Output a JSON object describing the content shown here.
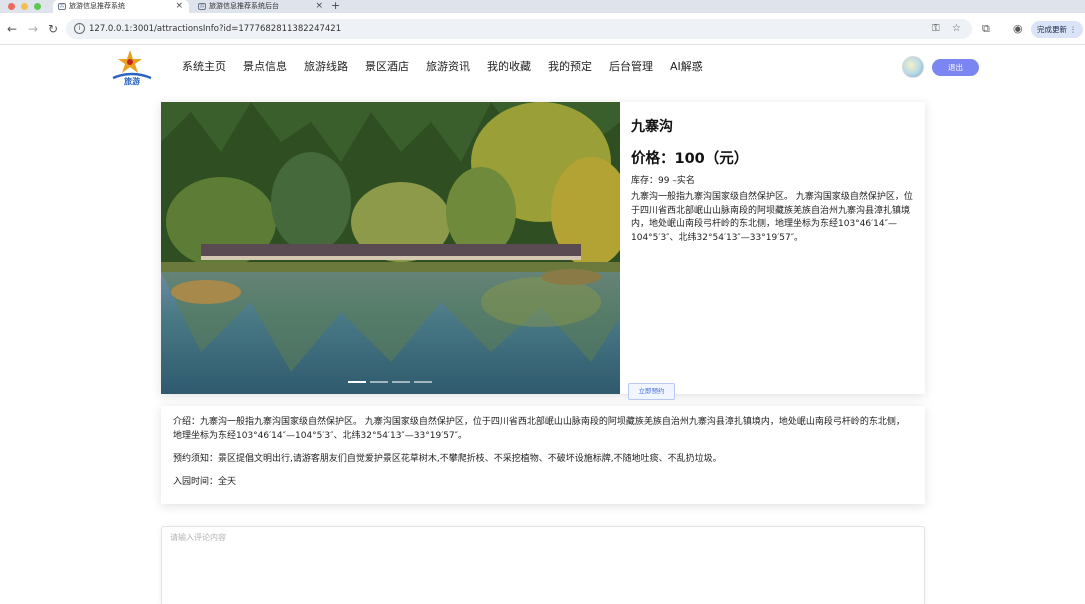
{
  "browser": {
    "tabs": [
      {
        "title": "旅游信息推荐系统",
        "favicon": "yun"
      },
      {
        "title": "旅游信息推荐系统后台",
        "favicon": "yun"
      }
    ],
    "url": "127.0.0.1:3001/attractionsInfo?id=1777682811382247421",
    "update_label": "完成更新"
  },
  "site": {
    "logo_text": "旅游",
    "nav": [
      "系统主页",
      "景点信息",
      "旅游线路",
      "景区酒店",
      "旅游资讯",
      "我的收藏",
      "我的预定",
      "后台管理",
      "AI解惑"
    ],
    "logout_label": "退出",
    "accent": "#7b86f2"
  },
  "attraction": {
    "name": "九寨沟",
    "price_text": "价格：100（元）",
    "stock_text": "库存：99 –实名",
    "description": "九寨沟一般指九寨沟国家级自然保护区。 九寨沟国家级自然保护区，位于四川省西北部岷山山脉南段的阿坝藏族羌族自治州九寨沟县漳扎镇境内，地处岷山南段弓杆岭的东北侧，地理坐标为东经103°46′14″—104°5′3″、北纬32°54′13″—33°19′57″。",
    "book_label": "立即预约",
    "carousel": {
      "slide_count": 4,
      "active": 0
    }
  },
  "intro": {
    "intro_text": "介绍：九寨沟一般指九寨沟国家级自然保护区。 九寨沟国家级自然保护区，位于四川省西北部岷山山脉南段的阿坝藏族羌族自治州九寨沟县漳扎镇境内，地处岷山南段弓杆岭的东北侧，地理坐标为东经103°46′14″—104°5′3″、北纬32°54′13″—33°19′57″。",
    "notice_text": "预约须知：景区提倡文明出行,请游客朋友们自觉爱护景区花草树木,不攀爬折枝、不采挖植物、不破坏设施标牌,不随地吐痰、不乱扔垃圾。",
    "hours_text": "入园时间：全天"
  },
  "comment": {
    "placeholder": "请输入评论内容"
  }
}
